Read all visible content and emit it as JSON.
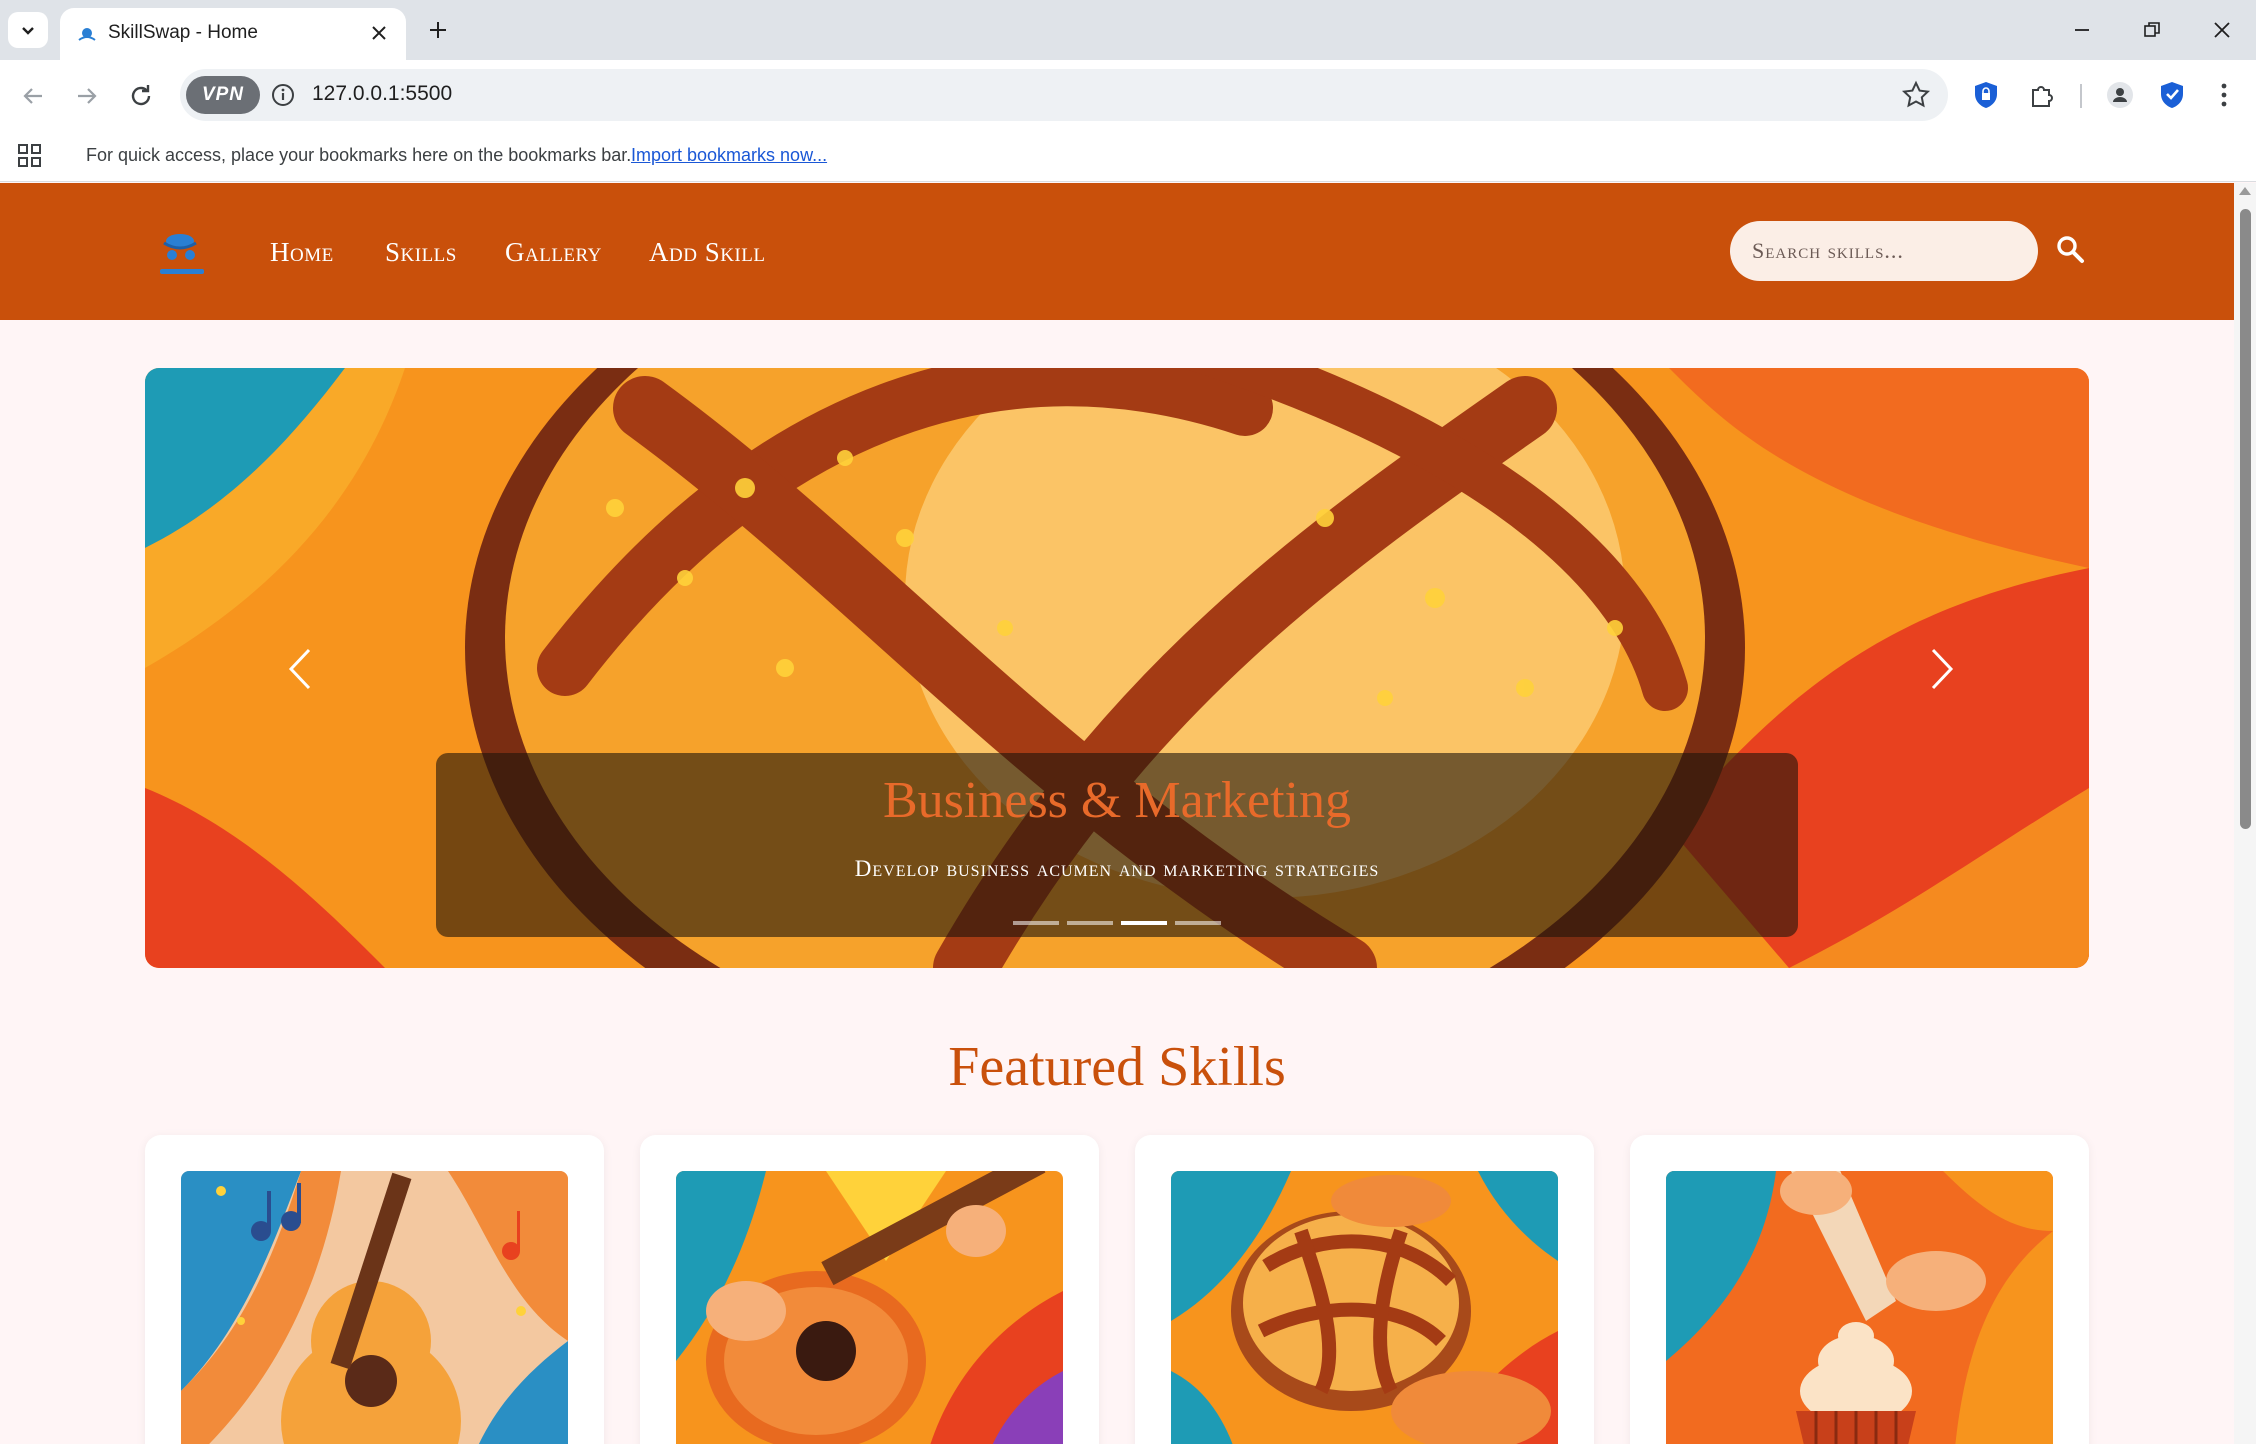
{
  "browser": {
    "tab_title": "SkillSwap - Home",
    "url": "127.0.0.1:5500",
    "vpn_label": "VPN",
    "bookmarks_prompt": "For quick access, place your bookmarks here on the bookmarks bar.",
    "bookmarks_link": "Import bookmarks now..."
  },
  "site": {
    "nav": [
      {
        "label": "Home"
      },
      {
        "label": "Skills"
      },
      {
        "label": "Gallery"
      },
      {
        "label": "Add Skill"
      }
    ],
    "search_placeholder": "Search skills..."
  },
  "carousel": {
    "title": "Business & Marketing",
    "text": "Develop business acumen and marketing strategies",
    "slide_count": 4,
    "active_index": 2
  },
  "featured": {
    "title": "Featured Skills",
    "cards": [
      {
        "icon": "guitar-music-illustration"
      },
      {
        "icon": "guitar-playing-illustration"
      },
      {
        "icon": "bread-loaf-illustration"
      },
      {
        "icon": "cupcake-icing-illustration"
      }
    ]
  },
  "colors": {
    "brand": "#c9500b",
    "page_bg": "#fff5f6",
    "caption_title": "#e86a2a"
  }
}
